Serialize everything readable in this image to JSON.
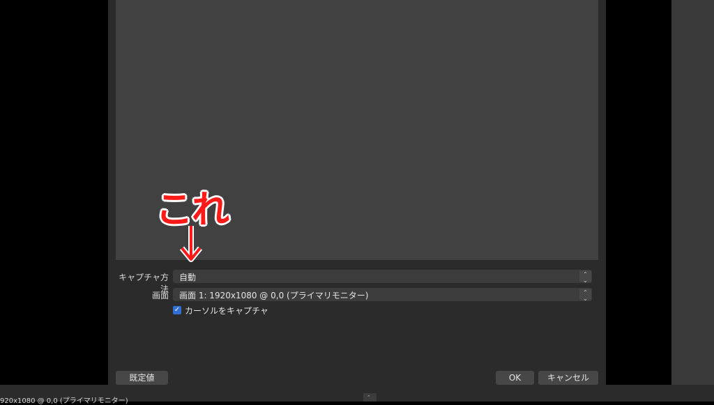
{
  "background": {
    "bottom_text": "920x1080 @ 0,0 (プライマリモニター)"
  },
  "annotation": {
    "text": "これ",
    "color": "#ff1a1a"
  },
  "form": {
    "capture_method_label": "キャプチャ方法",
    "capture_method_value": "自動",
    "display_label": "画面",
    "display_value": "画面 1: 1920x1080 @ 0,0 (プライマリモニター)",
    "cursor_checkbox_label": "カーソルをキャプチャ",
    "cursor_checked": true
  },
  "buttons": {
    "defaults": "既定値",
    "ok": "OK",
    "cancel": "キャンセル"
  },
  "colors": {
    "checkbox_accent": "#2f6fd6"
  }
}
